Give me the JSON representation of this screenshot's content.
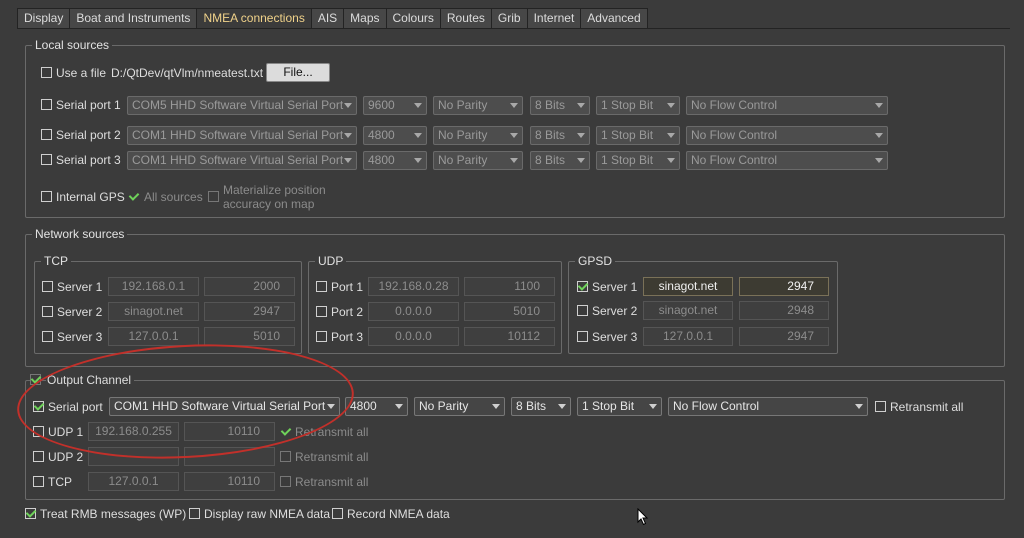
{
  "tabs": [
    "Display",
    "Boat and Instruments",
    "NMEA connections",
    "AIS",
    "Maps",
    "Colours",
    "Routes",
    "Grib",
    "Internet",
    "Advanced"
  ],
  "local": {
    "title": "Local sources",
    "use_file_label": "Use a file",
    "file_path": "D:/QtDev/qtVlm/nmeatest.txt",
    "file_button": "File...",
    "serial_ports": [
      {
        "label": "Serial port 1",
        "port": "COM5 HHD Software Virtual Serial Port",
        "baud": "9600",
        "parity": "No Parity",
        "bits": "8 Bits",
        "stop": "1 Stop Bit",
        "flow": "No Flow Control"
      },
      {
        "label": "Serial port 2",
        "port": "COM1 HHD Software Virtual Serial Port",
        "baud": "4800",
        "parity": "No Parity",
        "bits": "8 Bits",
        "stop": "1 Stop Bit",
        "flow": "No Flow Control"
      },
      {
        "label": "Serial port 3",
        "port": "COM1 HHD Software Virtual Serial Port",
        "baud": "4800",
        "parity": "No Parity",
        "bits": "8 Bits",
        "stop": "1 Stop Bit",
        "flow": "No Flow Control"
      }
    ],
    "internal_gps": "Internal GPS",
    "all_sources": "All sources",
    "materialize_1": "Materialize position",
    "materialize_2": "accuracy on map"
  },
  "network": {
    "title": "Network sources",
    "tcp": {
      "title": "TCP",
      "rows": [
        {
          "label": "Server 1",
          "host": "192.168.0.1",
          "port": "2000"
        },
        {
          "label": "Server 2",
          "host": "sinagot.net",
          "port": "2947"
        },
        {
          "label": "Server 3",
          "host": "127.0.0.1",
          "port": "5010"
        }
      ]
    },
    "udp": {
      "title": "UDP",
      "rows": [
        {
          "label": "Port 1",
          "host": "192.168.0.28",
          "port": "1100"
        },
        {
          "label": "Port 2",
          "host": "0.0.0.0",
          "port": "5010"
        },
        {
          "label": "Port 3",
          "host": "0.0.0.0",
          "port": "10112"
        }
      ]
    },
    "gpsd": {
      "title": "GPSD",
      "rows": [
        {
          "label": "Server 1",
          "host": "sinagot.net",
          "port": "2947"
        },
        {
          "label": "Server 2",
          "host": "sinagot.net",
          "port": "2948"
        },
        {
          "label": "Server 3",
          "host": "127.0.0.1",
          "port": "2947"
        }
      ]
    }
  },
  "output": {
    "title": "Output Channel",
    "serial_label": "Serial port",
    "serial": {
      "port": "COM1 HHD Software Virtual Serial Port",
      "baud": "4800",
      "parity": "No Parity",
      "bits": "8 Bits",
      "stop": "1 Stop Bit",
      "flow": "No Flow Control"
    },
    "retransmit": "Retransmit all",
    "rows": [
      {
        "label": "UDP 1",
        "host": "192.168.0.255",
        "port": "10110"
      },
      {
        "label": "UDP 2",
        "host": "",
        "port": ""
      },
      {
        "label": "TCP",
        "host": "127.0.0.1",
        "port": "10110"
      }
    ]
  },
  "footer": {
    "treat_rmb": "Treat RMB messages (WP)",
    "display_raw": "Display raw NMEA data",
    "record": "Record NMEA data"
  },
  "colors": {
    "accent_tab": "#f0d28a",
    "check": "#6fd25a",
    "annotation": "#c2302a"
  }
}
